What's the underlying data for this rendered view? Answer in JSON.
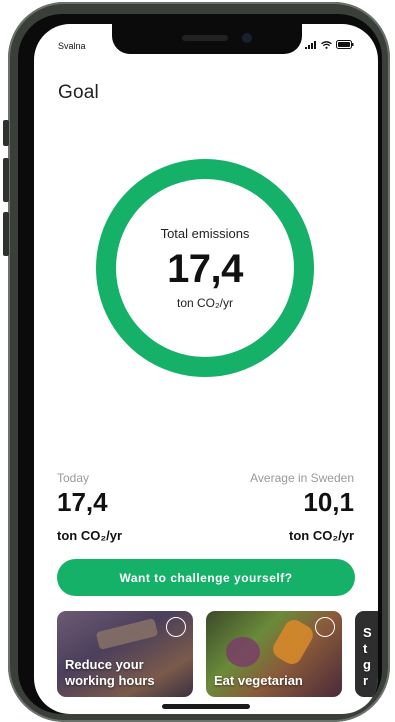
{
  "status_bar": {
    "carrier": "Svalna"
  },
  "header": {
    "title": "Goal"
  },
  "ring": {
    "caption": "Total emissions",
    "value": "17,4",
    "unit": "ton CO₂/yr",
    "color": "#16b169"
  },
  "stats": {
    "today": {
      "label": "Today",
      "value": "17,4",
      "unit": "ton CO₂/yr"
    },
    "average": {
      "label": "Average in Sweden",
      "value": "10,1",
      "unit": "ton CO₂/yr"
    }
  },
  "cta": {
    "label": "Want to challenge yourself?",
    "color": "#16b169"
  },
  "cards": [
    {
      "label": "Reduce your working hours",
      "icon": "check-circle-icon"
    },
    {
      "label": "Eat vegetarian",
      "icon": "check-circle-icon"
    },
    {
      "label": "St gr"
    }
  ]
}
